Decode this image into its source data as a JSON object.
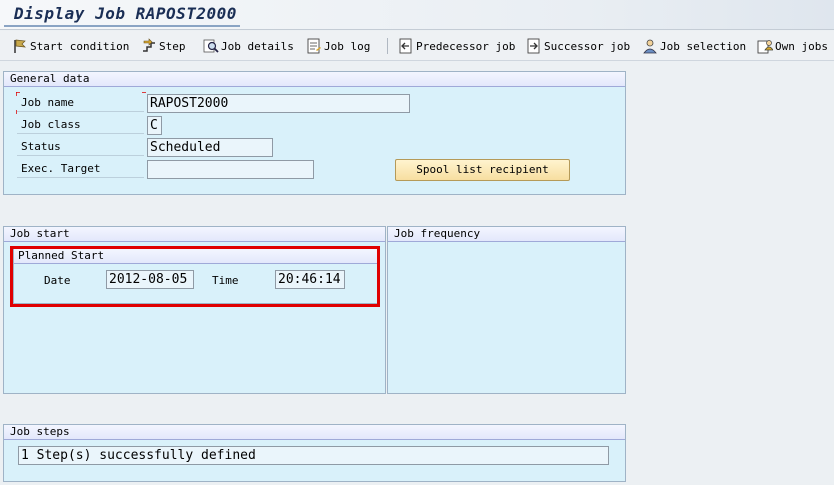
{
  "window": {
    "title": "Display Job RAPOST2000"
  },
  "toolbar": {
    "items": [
      {
        "label": "Start condition",
        "icon": "flag-icon"
      },
      {
        "label": "Step",
        "icon": "step-icon"
      },
      {
        "label": "Job details",
        "icon": "magnifier-icon"
      },
      {
        "label": "Job log",
        "icon": "log-icon"
      },
      {
        "label": "Predecessor job",
        "icon": "predecessor-icon"
      },
      {
        "label": "Successor job",
        "icon": "successor-icon"
      },
      {
        "label": "Job selection",
        "icon": "person-icon"
      },
      {
        "label": "Own jobs",
        "icon": "own-jobs-icon"
      }
    ]
  },
  "general": {
    "header": "General data",
    "job_name_label": "Job name",
    "job_name_value": "RAPOST2000",
    "job_class_label": "Job class",
    "job_class_value": "C",
    "status_label": "Status",
    "status_value": "Scheduled",
    "exec_target_label": "Exec. Target",
    "exec_target_value": "",
    "spool_button": "Spool list recipient"
  },
  "job_start": {
    "header": "Job start",
    "planned_start_header": "Planned Start",
    "date_label": "Date",
    "date_value": "2012-08-05",
    "time_label": "Time",
    "time_value": "20:46:14"
  },
  "job_frequency": {
    "header": "Job frequency"
  },
  "job_steps": {
    "header": "Job steps",
    "message": "1 Step(s) successfully defined"
  },
  "colors": {
    "panel_bg": "#d9f1fa",
    "highlight": "#e00000",
    "button_bg": "#f7dea0"
  }
}
